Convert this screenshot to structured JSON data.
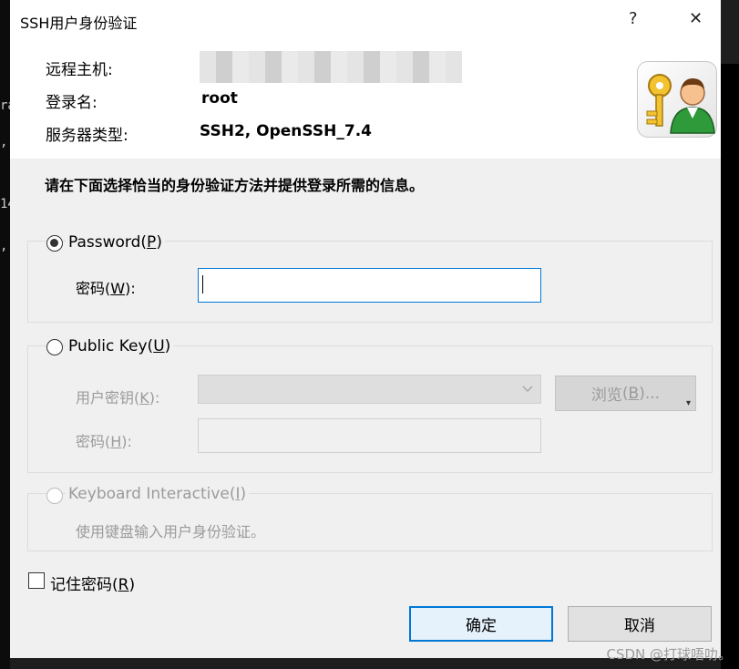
{
  "window": {
    "title": "SSH用户身份验证",
    "help_glyph": "?",
    "close_glyph": "✕"
  },
  "terminal_fragments": [
    "ra",
    ",",
    "14",
    ","
  ],
  "header": {
    "host_label": "远程主机:",
    "login_label": "登录名:",
    "login_value": "root",
    "server_type_label": "服务器类型:",
    "server_type_value": "SSH2, OpenSSH_7.4"
  },
  "instruction": "请在下面选择恰当的身份验证方法并提供登录所需的信息。",
  "password_method": {
    "label": "Password",
    "accel": "P",
    "selected": true,
    "password_label": "密码",
    "password_accel": "W",
    "password_value": ""
  },
  "publickey_method": {
    "label": "Public Key",
    "accel": "U",
    "selected": false,
    "user_key_label": "用户密钥",
    "user_key_accel": "K",
    "user_key_value": "",
    "browse_label": "浏览",
    "browse_accel": "B",
    "browse_suffix": "...",
    "password_label": "密码",
    "password_accel": "H"
  },
  "keyboard_method": {
    "label": "Keyboard Interactive",
    "accel": "I",
    "description": "使用键盘输入用户身份验证。"
  },
  "remember": {
    "label": "记住密码",
    "accel": "R",
    "checked": false
  },
  "buttons": {
    "ok": "确定",
    "cancel": "取消"
  },
  "watermark": "CSDN @打球唔叻。"
}
